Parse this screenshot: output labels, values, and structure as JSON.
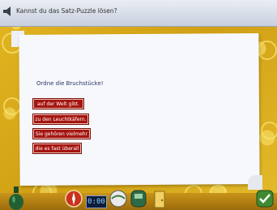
{
  "window": {
    "title": "Kannst du das Satz-Puzzle lösen?"
  },
  "puzzle": {
    "instruction": "Ordne die Bruchstücke!",
    "pieces": [
      "auf der Welt gibt.",
      "zu den Leuchtkäfern.",
      "Sie gehören vielmehr",
      "die es fast überall"
    ]
  },
  "toolbar": {
    "counter_text": "0:00"
  },
  "colors": {
    "background": "#d6aa1c",
    "piece": "#a5150f",
    "instruction_text": "#2a3468",
    "paper": "#f7f8fb"
  },
  "icons": [
    "speaker-icon",
    "bottle-icon",
    "compass-icon",
    "lcd-counter-icon",
    "globe-icon",
    "phone-icon",
    "door-icon",
    "check-icon"
  ]
}
